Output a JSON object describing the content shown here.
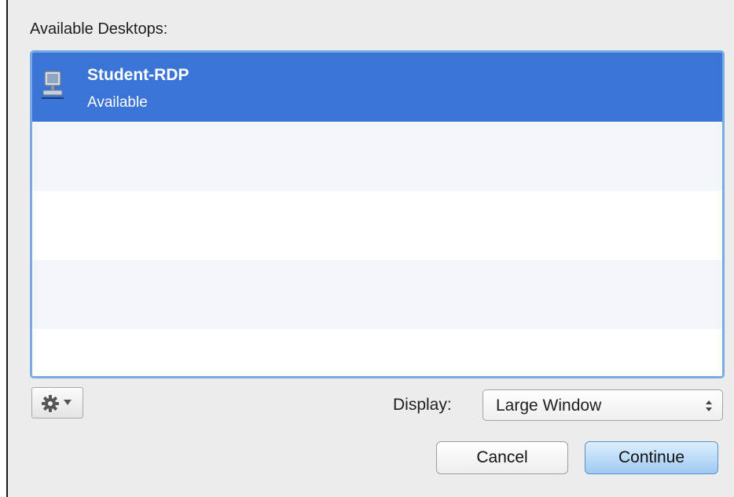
{
  "dialog": {
    "list_title": "Available Desktops:",
    "desktops": [
      {
        "name": "Student-RDP",
        "status": "Available",
        "icon": "computer-icon",
        "selected": true
      }
    ]
  },
  "toolbar": {
    "gear_icon": "gear-icon",
    "caret_icon": "chevron-down-icon"
  },
  "display": {
    "label": "Display:",
    "selected_value": "Large Window"
  },
  "buttons": {
    "cancel_label": "Cancel",
    "continue_label": "Continue"
  },
  "colors": {
    "selection": "#3a74d6",
    "focus_ring": "#7aaae6",
    "default_button": "#9fcaf2"
  }
}
